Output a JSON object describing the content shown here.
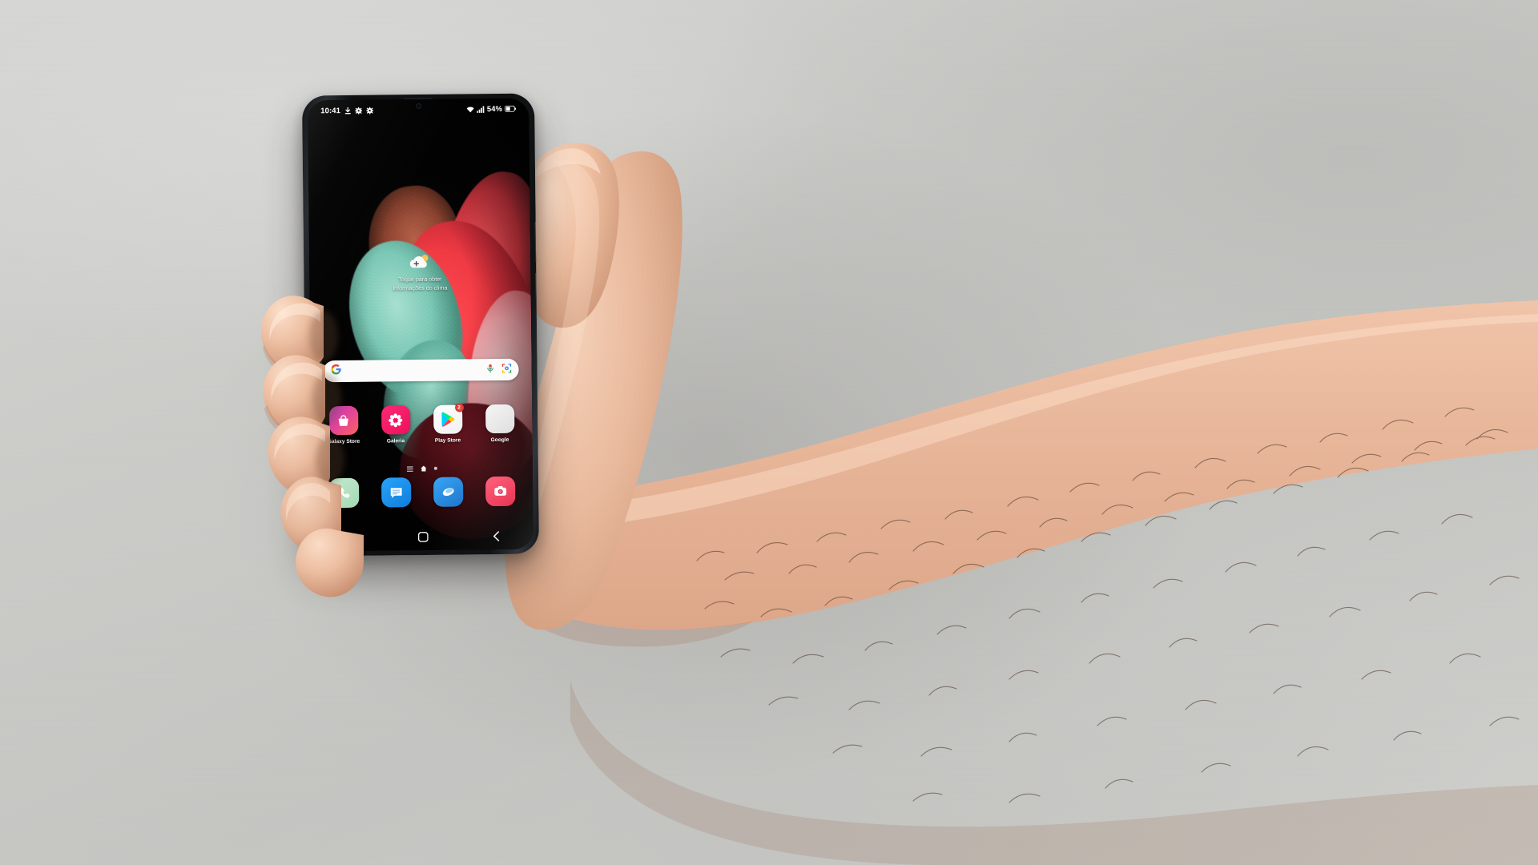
{
  "scene": {
    "description": "Hand holding a Samsung Galaxy S21 Ultra smartphone in front of a light gray wall",
    "wall_color": "#c9c9c7",
    "skin_color": "#e8b79b",
    "phone_frame_color": "#15171a"
  },
  "phone": {
    "statusbar": {
      "time": "10:41",
      "left_icons": [
        "download-icon",
        "settings-gear-icon",
        "settings-gear-icon"
      ],
      "right_icons": [
        "wifi-icon",
        "signal-bars-icon"
      ],
      "battery_percent": "54%",
      "battery_icon": "battery-icon"
    },
    "weather_widget": {
      "icon": "cloud-plus-icon",
      "text_line1": "Toque para obter",
      "text_line2": "informações do clima",
      "full_text": "Toque para obter informações do clima"
    },
    "search": {
      "logo": "google-g-icon",
      "placeholder": "",
      "value": "",
      "mic_icon": "microphone-icon",
      "lens_icon": "google-lens-icon"
    },
    "apps": [
      {
        "label": "Galaxy Store",
        "icon": "galaxy-store-icon",
        "badge": "",
        "color_a": "#c13fb0",
        "color_b": "#f2565c"
      },
      {
        "label": "Galeria",
        "icon": "gallery-flower-icon",
        "badge": "",
        "color_a": "#f5256b",
        "color_b": "#e6145c"
      },
      {
        "label": "Play Store",
        "icon": "play-store-icon",
        "badge": "2",
        "color_a": "#ffffff",
        "color_b": "#f3f3f3"
      },
      {
        "label": "Google",
        "icon": "google-folder-icon",
        "badge": "",
        "color_a": "#f0f0f0",
        "color_b": "#dcdcdc"
      }
    ],
    "page_indicator": {
      "items": [
        "apps-list-icon",
        "home-page-icon",
        "page-dot-icon"
      ],
      "active_index": 1
    },
    "dock": [
      {
        "label": "Telefone",
        "icon": "phone-icon",
        "color_a": "#b9e6c3",
        "color_b": "#a5dcb3"
      },
      {
        "label": "Mensagens",
        "icon": "messages-icon",
        "color_a": "#1b96f3",
        "color_b": "#1283e0"
      },
      {
        "label": "Internet",
        "icon": "browser-icon",
        "color_a": "#2f9ff0",
        "color_b": "#1f7fd4"
      },
      {
        "label": "Câmera",
        "icon": "camera-icon",
        "color_a": "#f84d6d",
        "color_b": "#e8304f"
      }
    ],
    "navbar": {
      "recents_label": "recents-icon",
      "home_label": "home-icon",
      "back_label": "back-icon"
    },
    "hardware": {
      "front_camera": "front-camera-icon",
      "earpiece": "earpiece-speaker",
      "side_buttons": [
        "volume-button",
        "power-button"
      ]
    }
  }
}
